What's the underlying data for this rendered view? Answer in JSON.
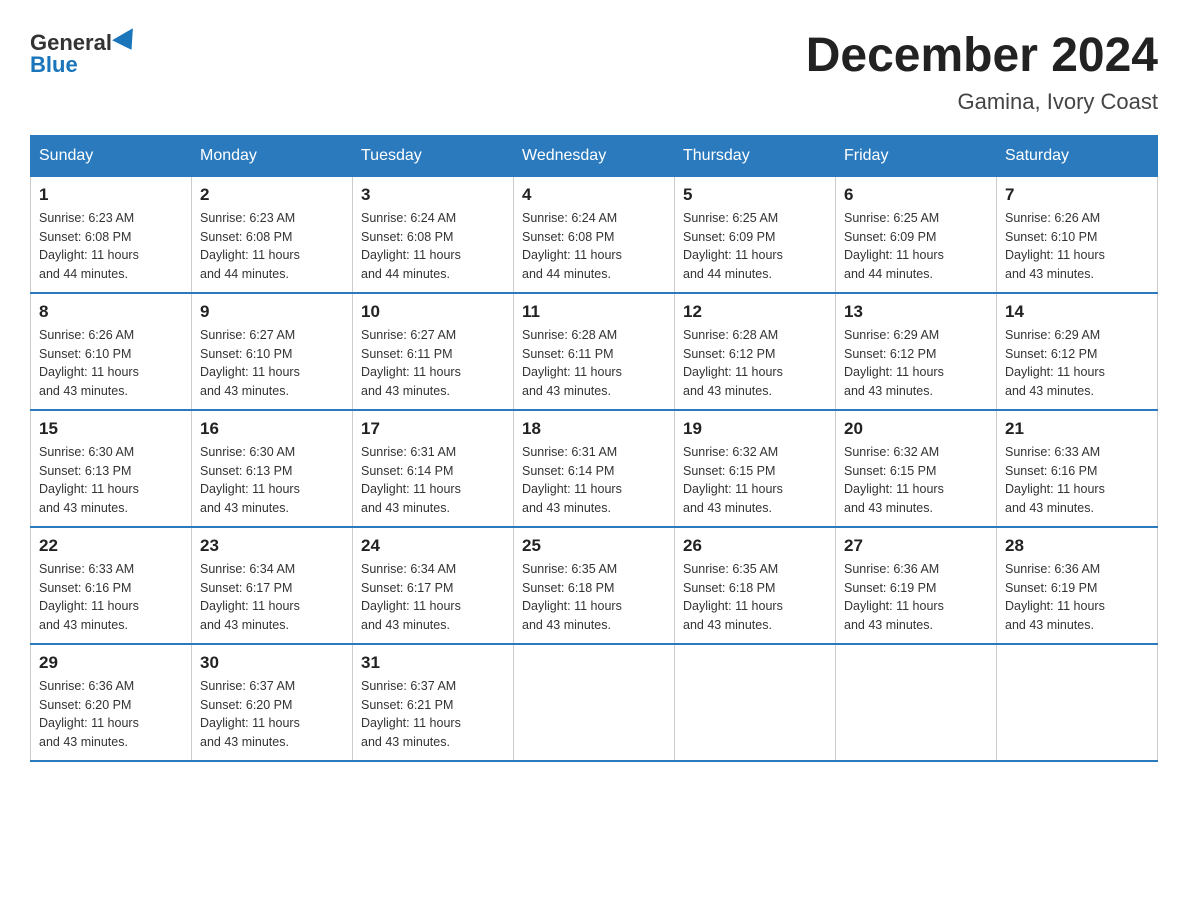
{
  "logo": {
    "general": "General",
    "blue": "Blue"
  },
  "title": "December 2024",
  "subtitle": "Gamina, Ivory Coast",
  "days_of_week": [
    "Sunday",
    "Monday",
    "Tuesday",
    "Wednesday",
    "Thursday",
    "Friday",
    "Saturday"
  ],
  "weeks": [
    [
      {
        "day": "1",
        "sunrise": "6:23 AM",
        "sunset": "6:08 PM",
        "daylight": "11 hours and 44 minutes."
      },
      {
        "day": "2",
        "sunrise": "6:23 AM",
        "sunset": "6:08 PM",
        "daylight": "11 hours and 44 minutes."
      },
      {
        "day": "3",
        "sunrise": "6:24 AM",
        "sunset": "6:08 PM",
        "daylight": "11 hours and 44 minutes."
      },
      {
        "day": "4",
        "sunrise": "6:24 AM",
        "sunset": "6:08 PM",
        "daylight": "11 hours and 44 minutes."
      },
      {
        "day": "5",
        "sunrise": "6:25 AM",
        "sunset": "6:09 PM",
        "daylight": "11 hours and 44 minutes."
      },
      {
        "day": "6",
        "sunrise": "6:25 AM",
        "sunset": "6:09 PM",
        "daylight": "11 hours and 44 minutes."
      },
      {
        "day": "7",
        "sunrise": "6:26 AM",
        "sunset": "6:10 PM",
        "daylight": "11 hours and 43 minutes."
      }
    ],
    [
      {
        "day": "8",
        "sunrise": "6:26 AM",
        "sunset": "6:10 PM",
        "daylight": "11 hours and 43 minutes."
      },
      {
        "day": "9",
        "sunrise": "6:27 AM",
        "sunset": "6:10 PM",
        "daylight": "11 hours and 43 minutes."
      },
      {
        "day": "10",
        "sunrise": "6:27 AM",
        "sunset": "6:11 PM",
        "daylight": "11 hours and 43 minutes."
      },
      {
        "day": "11",
        "sunrise": "6:28 AM",
        "sunset": "6:11 PM",
        "daylight": "11 hours and 43 minutes."
      },
      {
        "day": "12",
        "sunrise": "6:28 AM",
        "sunset": "6:12 PM",
        "daylight": "11 hours and 43 minutes."
      },
      {
        "day": "13",
        "sunrise": "6:29 AM",
        "sunset": "6:12 PM",
        "daylight": "11 hours and 43 minutes."
      },
      {
        "day": "14",
        "sunrise": "6:29 AM",
        "sunset": "6:12 PM",
        "daylight": "11 hours and 43 minutes."
      }
    ],
    [
      {
        "day": "15",
        "sunrise": "6:30 AM",
        "sunset": "6:13 PM",
        "daylight": "11 hours and 43 minutes."
      },
      {
        "day": "16",
        "sunrise": "6:30 AM",
        "sunset": "6:13 PM",
        "daylight": "11 hours and 43 minutes."
      },
      {
        "day": "17",
        "sunrise": "6:31 AM",
        "sunset": "6:14 PM",
        "daylight": "11 hours and 43 minutes."
      },
      {
        "day": "18",
        "sunrise": "6:31 AM",
        "sunset": "6:14 PM",
        "daylight": "11 hours and 43 minutes."
      },
      {
        "day": "19",
        "sunrise": "6:32 AM",
        "sunset": "6:15 PM",
        "daylight": "11 hours and 43 minutes."
      },
      {
        "day": "20",
        "sunrise": "6:32 AM",
        "sunset": "6:15 PM",
        "daylight": "11 hours and 43 minutes."
      },
      {
        "day": "21",
        "sunrise": "6:33 AM",
        "sunset": "6:16 PM",
        "daylight": "11 hours and 43 minutes."
      }
    ],
    [
      {
        "day": "22",
        "sunrise": "6:33 AM",
        "sunset": "6:16 PM",
        "daylight": "11 hours and 43 minutes."
      },
      {
        "day": "23",
        "sunrise": "6:34 AM",
        "sunset": "6:17 PM",
        "daylight": "11 hours and 43 minutes."
      },
      {
        "day": "24",
        "sunrise": "6:34 AM",
        "sunset": "6:17 PM",
        "daylight": "11 hours and 43 minutes."
      },
      {
        "day": "25",
        "sunrise": "6:35 AM",
        "sunset": "6:18 PM",
        "daylight": "11 hours and 43 minutes."
      },
      {
        "day": "26",
        "sunrise": "6:35 AM",
        "sunset": "6:18 PM",
        "daylight": "11 hours and 43 minutes."
      },
      {
        "day": "27",
        "sunrise": "6:36 AM",
        "sunset": "6:19 PM",
        "daylight": "11 hours and 43 minutes."
      },
      {
        "day": "28",
        "sunrise": "6:36 AM",
        "sunset": "6:19 PM",
        "daylight": "11 hours and 43 minutes."
      }
    ],
    [
      {
        "day": "29",
        "sunrise": "6:36 AM",
        "sunset": "6:20 PM",
        "daylight": "11 hours and 43 minutes."
      },
      {
        "day": "30",
        "sunrise": "6:37 AM",
        "sunset": "6:20 PM",
        "daylight": "11 hours and 43 minutes."
      },
      {
        "day": "31",
        "sunrise": "6:37 AM",
        "sunset": "6:21 PM",
        "daylight": "11 hours and 43 minutes."
      },
      null,
      null,
      null,
      null
    ]
  ],
  "labels": {
    "sunrise": "Sunrise:",
    "sunset": "Sunset:",
    "daylight": "Daylight:"
  }
}
